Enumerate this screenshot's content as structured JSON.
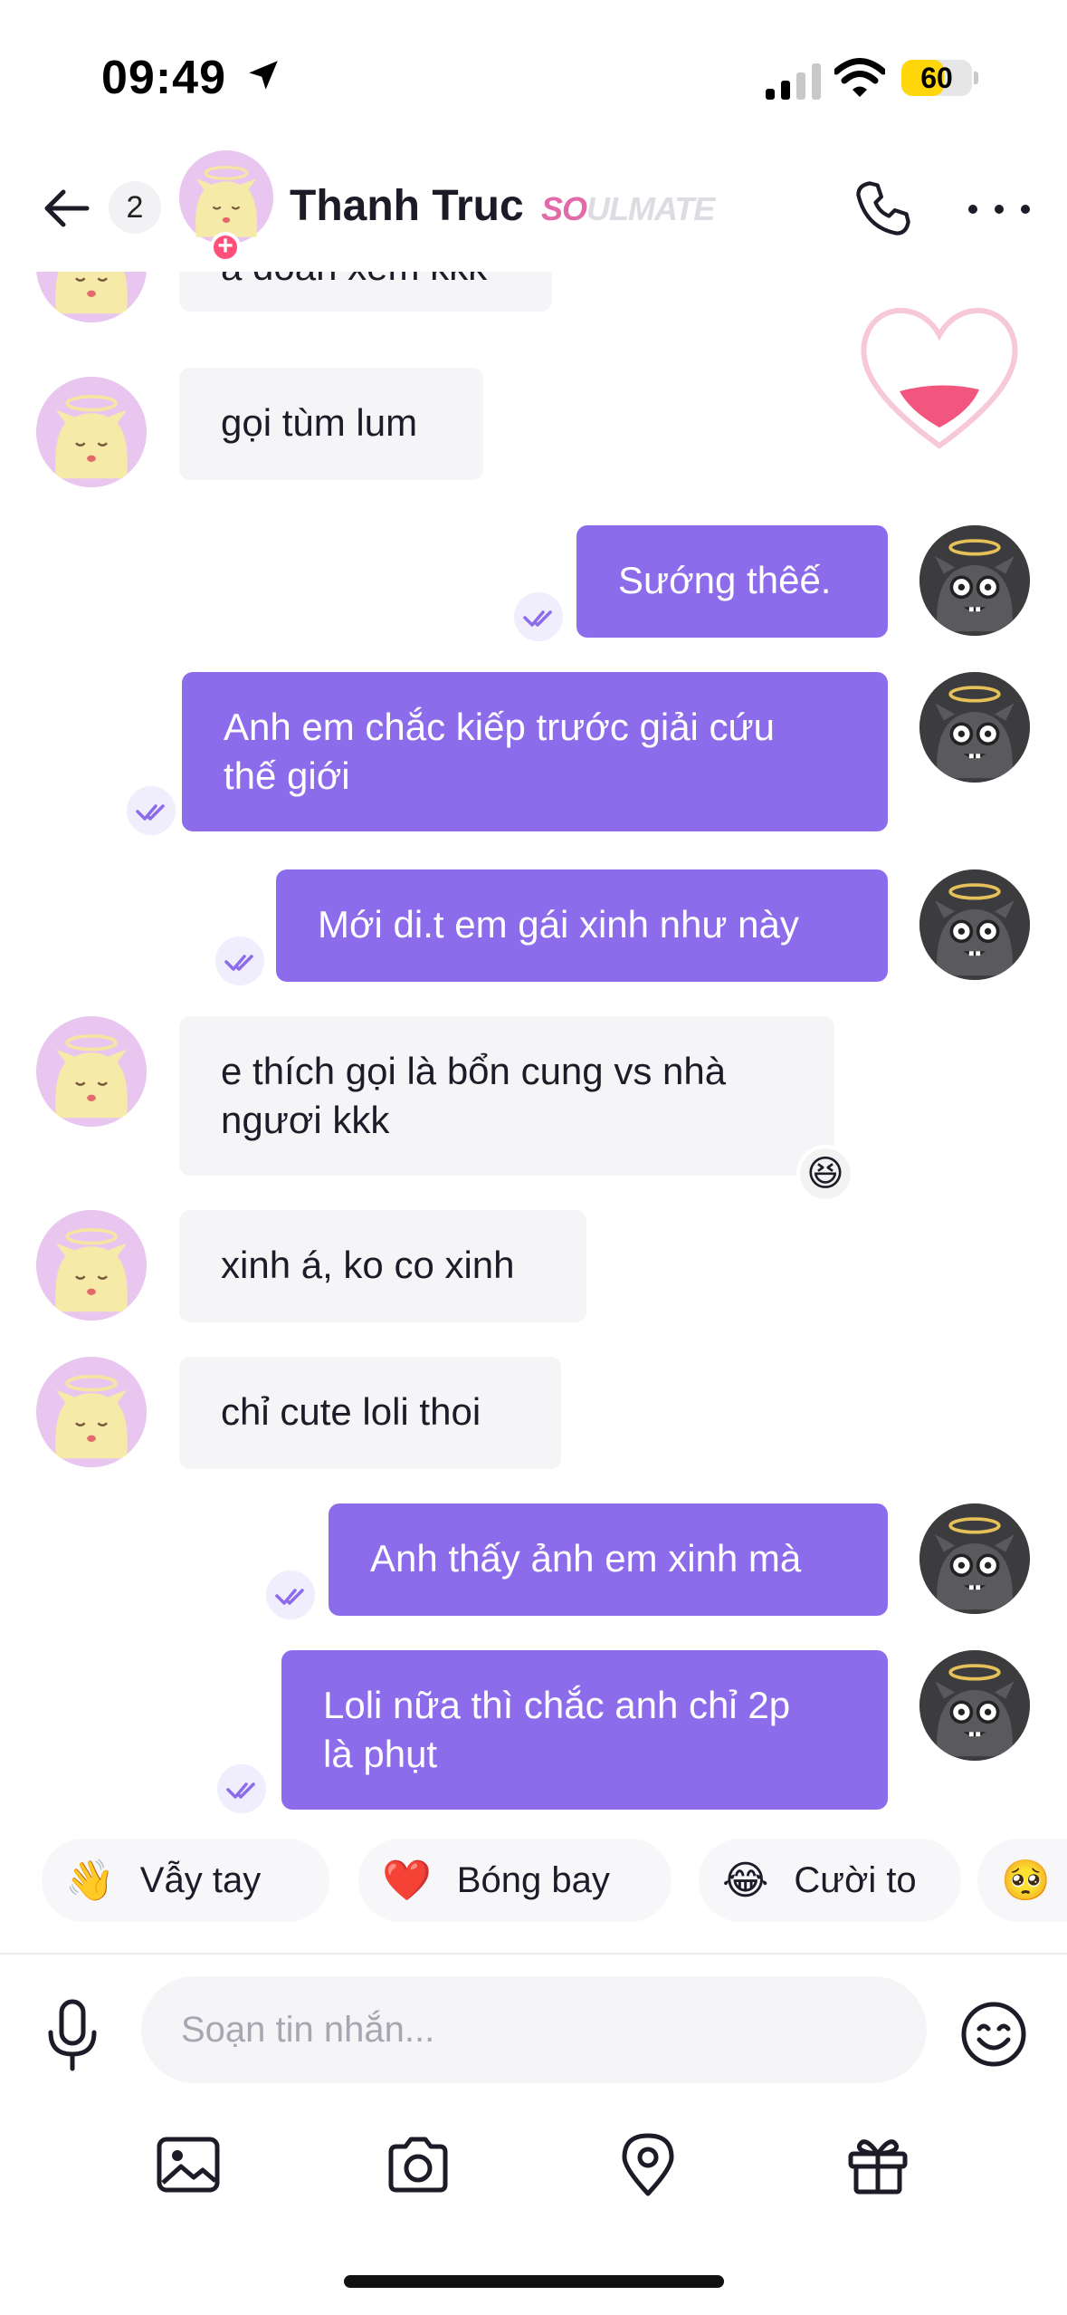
{
  "status_bar": {
    "time": "09:49",
    "battery": "60",
    "battery_level": 0.6,
    "battery_color": "#ffd60a"
  },
  "header": {
    "unread_count": "2",
    "contact_name": "Thanh Truc",
    "relationship_tag_highlight": "SO",
    "relationship_tag_rest": "ULMATE",
    "icons": [
      "arrow-left-icon",
      "phone-icon",
      "more-horizontal-icon"
    ]
  },
  "messages": [
    {
      "side": "in",
      "text": "a đoán xem kkk"
    },
    {
      "side": "in",
      "text": "gọi tùm lum"
    },
    {
      "side": "out",
      "text": "Sướng thêế."
    },
    {
      "side": "out",
      "text": "Anh em chắc kiếp trước giải cứu\nthế giới"
    },
    {
      "side": "out",
      "text": "Mới di.t em gái xinh như này"
    },
    {
      "side": "in",
      "text": "e thích gọi là bổn cung vs nhà\nngươi kkk",
      "reaction": "😆"
    },
    {
      "side": "in",
      "text": "xinh á, ko co xinh"
    },
    {
      "side": "in",
      "text": "chỉ cute loli thoi"
    },
    {
      "side": "out",
      "text": "Anh thấy ảnh em xinh mà"
    },
    {
      "side": "out",
      "text": "Loli nữa thì chắc anh chỉ 2p\nlà phụt"
    }
  ],
  "quick_reactions": [
    {
      "emoji": "👋",
      "label": "Vẫy tay"
    },
    {
      "emoji": "❤️",
      "label": "Bóng bay"
    },
    {
      "emoji": "😂",
      "label": "Cười to"
    },
    {
      "emoji": "🥺",
      "label": ""
    }
  ],
  "composer": {
    "placeholder": "Soạn tin nhắn...",
    "tools": [
      "image-icon",
      "camera-icon",
      "location-pin-icon",
      "gift-icon"
    ]
  },
  "colors": {
    "accent": "#8d6cec",
    "incoming_bubble": "#f5f5f8",
    "soulmate_pink": "#e36aa8"
  }
}
